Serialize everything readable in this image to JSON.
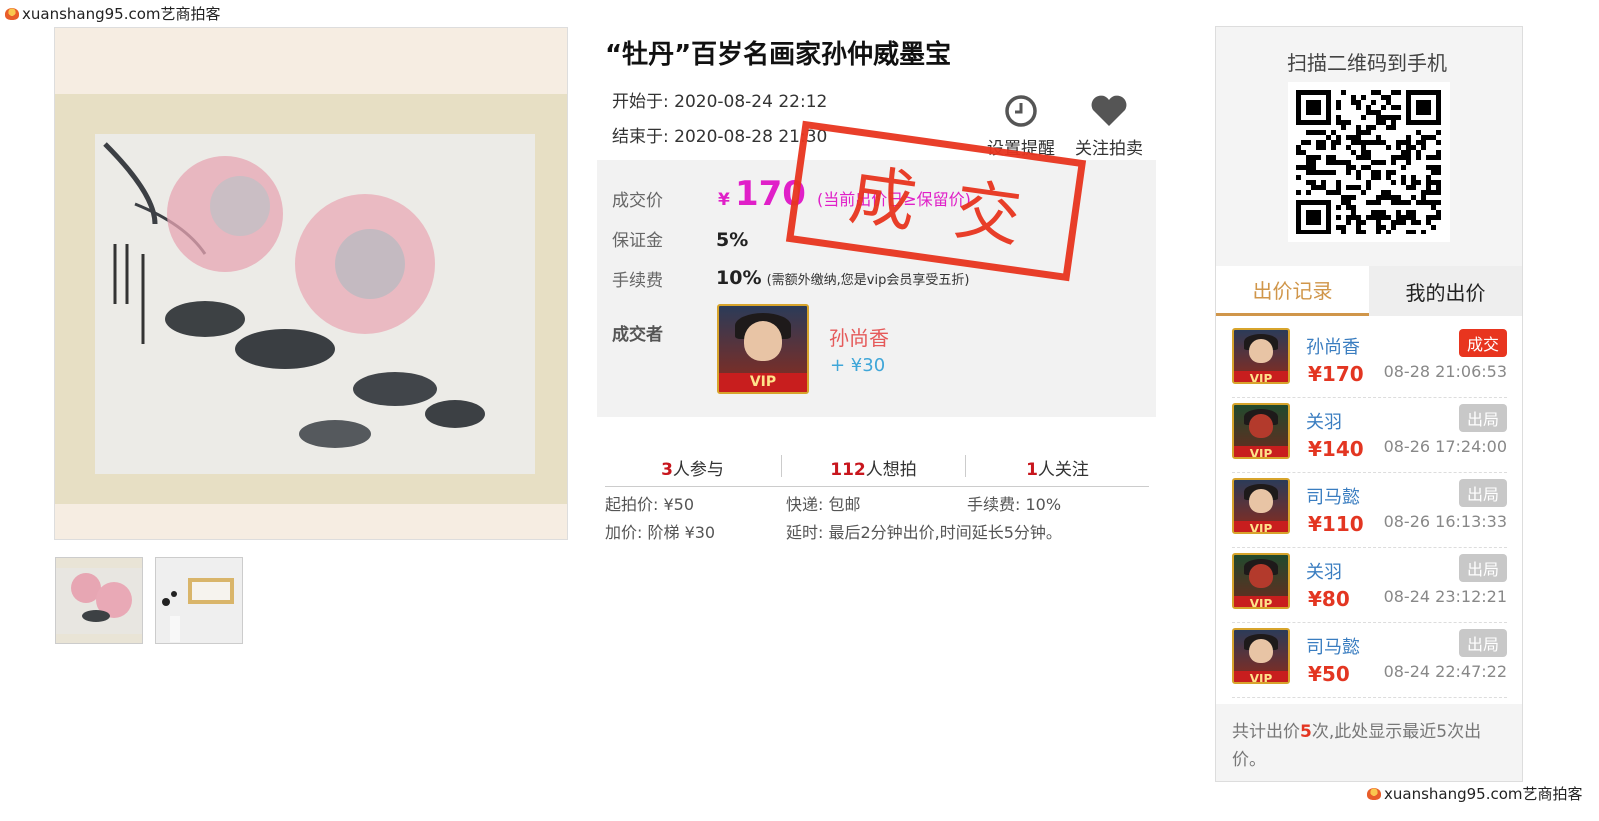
{
  "watermark": {
    "top": "xuanshang95.com艺商拍客",
    "bottom": "xuanshang95.com艺商拍客"
  },
  "title": "“牡丹”百岁名画家孙仲威墨宝",
  "start": {
    "label": "开始于:",
    "value": "2020-08-24 22:12"
  },
  "end": {
    "label": "结束于:",
    "value": "2020-08-28 21:30"
  },
  "actions": {
    "remind": "设置提醒",
    "follow": "关注拍卖"
  },
  "stamp": "成交",
  "deal": {
    "price_label": "成交价",
    "currency": "¥",
    "price": "170",
    "price_note": "(当前出价已≥保留价)",
    "deposit_label": "保证金",
    "deposit": "5%",
    "fee_label": "手续费",
    "fee": "10%",
    "fee_note": "(需额外缴纳,您是vip会员享受五折)",
    "winner_label": "成交者",
    "winner_name": "孙尚香",
    "winner_add": "+ ¥30",
    "vip": "VIP"
  },
  "stats": [
    {
      "count": "3",
      "label": "人参与"
    },
    {
      "count": "112",
      "label": "人想拍"
    },
    {
      "count": "1",
      "label": "人关注"
    }
  ],
  "terms": {
    "start_price": "起拍价: ¥50",
    "shipping": "快递: 包邮",
    "fee": "手续费: 10%",
    "increment": "加价: 阶梯 ¥30",
    "delay": "延时: 最后2分钟出价,时间延长5分钟。"
  },
  "qr_title": "扫描二维码到手机",
  "tabs": {
    "records": "出价记录",
    "mine": "我的出价"
  },
  "records": [
    {
      "name": "孙尚香",
      "amount": "¥170",
      "time": "08-28 21:06:53",
      "badge": "成交",
      "badge_color": "#e8351f",
      "avatar": "female"
    },
    {
      "name": "关羽",
      "amount": "¥140",
      "time": "08-26 17:24:00",
      "badge": "出局",
      "badge_color": "#c8c8c8",
      "avatar": "green"
    },
    {
      "name": "司马懿",
      "amount": "¥110",
      "time": "08-26 16:13:33",
      "badge": "出局",
      "badge_color": "#c8c8c8",
      "avatar": "male"
    },
    {
      "name": "关羽",
      "amount": "¥80",
      "time": "08-24 23:12:21",
      "badge": "出局",
      "badge_color": "#c8c8c8",
      "avatar": "green"
    },
    {
      "name": "司马懿",
      "amount": "¥50",
      "time": "08-24 22:47:22",
      "badge": "出局",
      "badge_color": "#c8c8c8",
      "avatar": "male"
    }
  ],
  "footer": {
    "prefix": "共计出价",
    "count": "5",
    "suffix": "次,此处显示最近5次出价。"
  },
  "colors": {
    "accent": "#e8351f",
    "magenta": "#e020c8",
    "tab_active": "#d0964a",
    "link": "#3a7dc0"
  }
}
